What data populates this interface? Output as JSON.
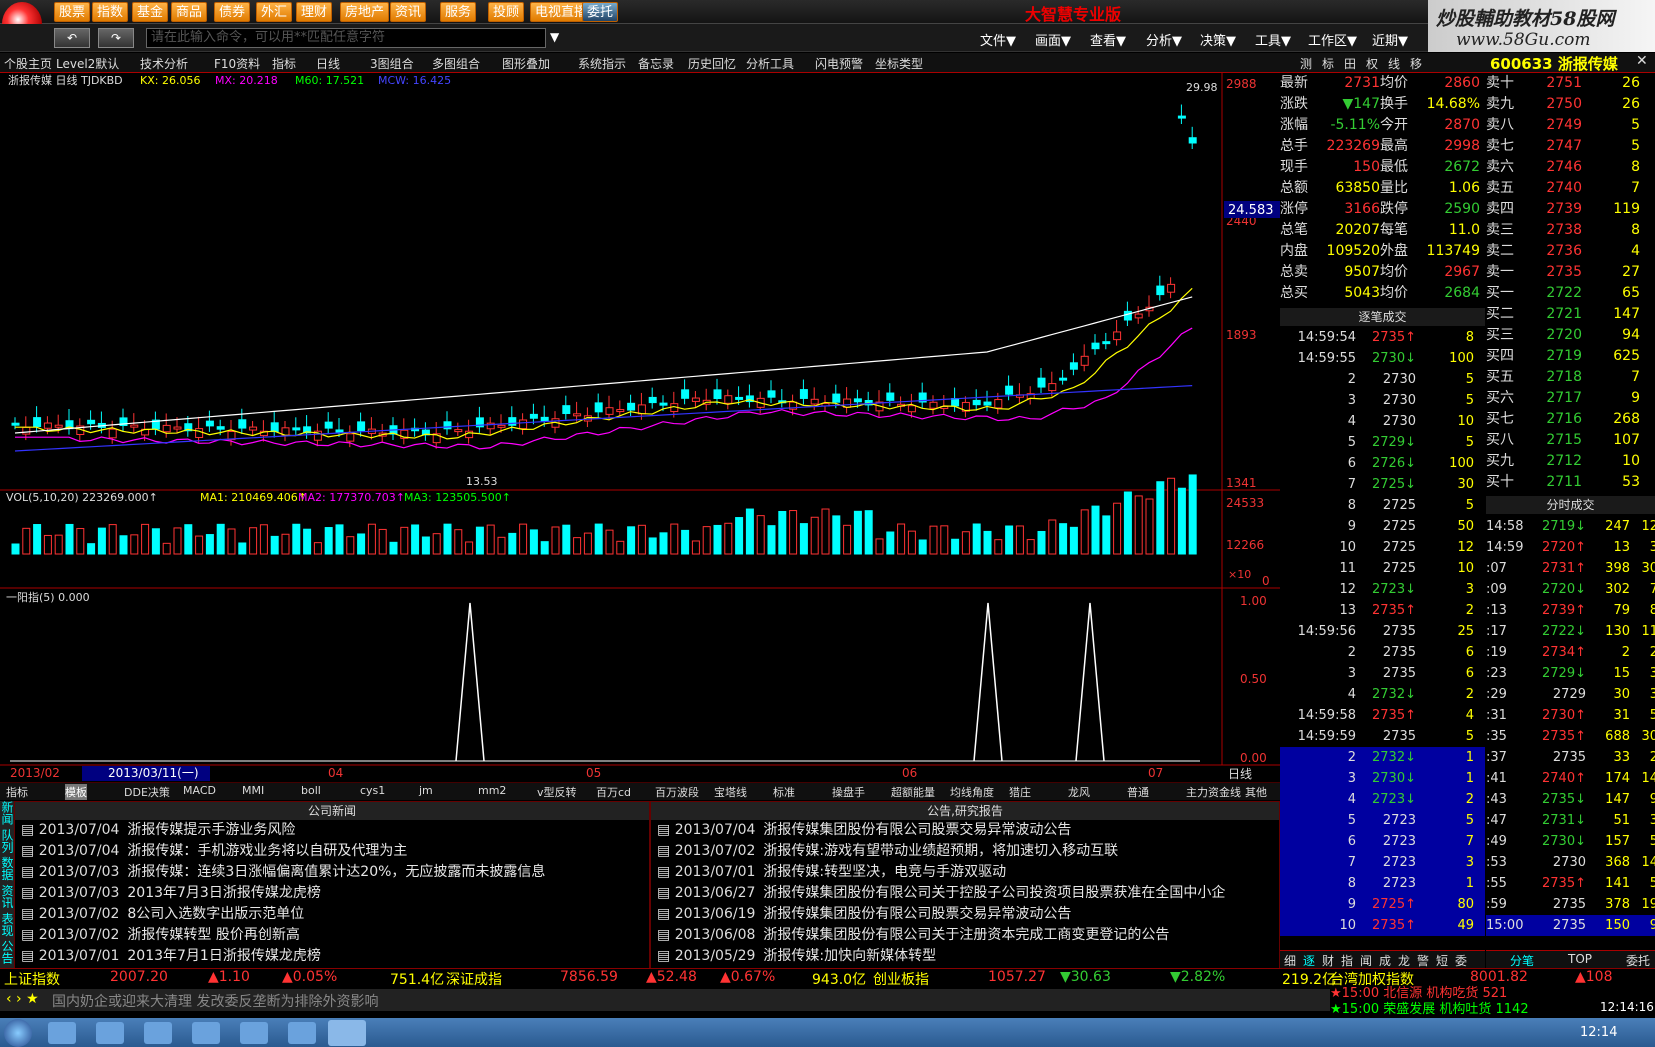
{
  "menu": {
    "items": [
      "股票",
      "指数",
      "基金",
      "商品",
      "债券",
      "外汇",
      "理财",
      "房地产",
      "资讯",
      "服务",
      "投顾",
      "电视直播",
      "委托"
    ],
    "title": "大智慧专业版",
    "cmd_placeholder": "请在此输入命令，可以用**匹配任意字符",
    "right": [
      "文件▼",
      "画面▼",
      "查看▼",
      "分析▼",
      "决策▼",
      "工具▼",
      "工作区▼",
      "近期▼"
    ],
    "banner1": "炒股輔助教材58股网",
    "banner2": "www.58Gu.com"
  },
  "toolbar": {
    "items": [
      "个股主页",
      "Level2默认",
      "技术分析",
      "F10资料",
      "指标",
      "日线",
      "3图组合",
      "多图组合",
      "图形叠加",
      "系统指示",
      "备忘录",
      "历史回忆",
      "分析工具",
      "闪电预警",
      "坐标类型"
    ],
    "right": [
      "测",
      "标",
      "田",
      "权",
      "线",
      "移"
    ],
    "stock": "600633 浙报传媒"
  },
  "chart": {
    "kline_label": "浙报传媒 日线 TJDKBD",
    "ma1": "KX: 26.056",
    "ma2": "MX: 20.218",
    "ma3": "M60: 17.521",
    "ma4": "MCW: 16.425",
    "price_axis": [
      "2988",
      "2440",
      "1893",
      "1341"
    ],
    "cursor_price": "24.583",
    "low_mark": "13.53",
    "high_mark": "29.98",
    "vol_label": "VOL(5,10,20) 223269.000↑",
    "vol_ma1": "MA1: 210469.406↑",
    "vol_ma2": "MA2: 177370.703↑",
    "vol_ma3": "MA3: 123505.500↑",
    "vol_axis": [
      "24533",
      "12266",
      "0"
    ],
    "vol_unit": "×10",
    "ind_label": "一阳指(5) 0.000",
    "ind_axis": [
      "1.00",
      "0.50",
      "0.00"
    ],
    "dates": [
      "2013/02",
      "2013/03/11(一)",
      "04",
      "05",
      "06",
      "07"
    ],
    "period": "日线"
  },
  "tabs": [
    "指标",
    "模板",
    "DDE决策",
    "MACD",
    "MMI",
    "boll",
    "cys1",
    "jm",
    "mm2",
    "v型反转",
    "百万cd",
    "百万波段",
    "宝塔线",
    "标准",
    "操盘手",
    "超额能量",
    "均线角度",
    "猎庄",
    "龙风",
    "普通",
    "主力资金线",
    "其他"
  ],
  "news": {
    "left_title": "公司新闻",
    "right_title": "公告,研究报告",
    "left": [
      [
        "2013/07/04",
        "浙报传媒提示手游业务风险"
      ],
      [
        "2013/07/04",
        "浙报传媒：手机游戏业务将以自研及代理为主"
      ],
      [
        "2013/07/03",
        "浙报传媒：连续3日涨幅偏离值累计达20%，无应披露而未披露信息"
      ],
      [
        "2013/07/03",
        "2013年7月3日浙报传媒龙虎榜"
      ],
      [
        "2013/07/02",
        "8公司入选数字出版示范单位"
      ],
      [
        "2013/07/02",
        "浙报传媒转型 股价再创新高"
      ],
      [
        "2013/07/01",
        "2013年7月1日浙报传媒龙虎榜"
      ]
    ],
    "right": [
      [
        "2013/07/04",
        "浙报传媒集团股份有限公司股票交易异常波动公告"
      ],
      [
        "2013/07/02",
        "浙报传媒:游戏有望带动业绩超预期，将加速切入移动互联"
      ],
      [
        "2013/07/01",
        "浙报传媒:转型坚决，电竞与手游双驱动"
      ],
      [
        "2013/06/27",
        "浙报传媒集团股份有限公司关于控股子公司投资项目股票获准在全国中小企"
      ],
      [
        "2013/06/19",
        "浙报传媒集团股份有限公司股票交易异常波动公告"
      ],
      [
        "2013/06/08",
        "浙报传媒集团股份有限公司关于注册资本完成工商变更登记的公告"
      ],
      [
        "2013/05/29",
        "浙报传媒:加快向新媒体转型"
      ]
    ],
    "side": "新闻 队列 数据 资讯 表现 公告 相关"
  },
  "quote": [
    [
      "最新",
      "2731",
      "均价",
      "2860"
    ],
    [
      "涨跌",
      "▼147",
      "换手",
      "14.68%"
    ],
    [
      "涨幅",
      "-5.11%",
      "今开",
      "2870"
    ],
    [
      "总手",
      "223269",
      "最高",
      "2998"
    ],
    [
      "现手",
      "150",
      "最低",
      "2672"
    ],
    [
      "总额",
      "63850",
      "量比",
      "1.06"
    ],
    [
      "涨停",
      "3166",
      "跌停",
      "2590"
    ],
    [
      "总笔",
      "20207",
      "每笔",
      "11.0"
    ],
    [
      "内盘",
      "109520",
      "外盘",
      "113749"
    ],
    [
      "总卖",
      "9507",
      "均价",
      "2967"
    ],
    [
      "总买",
      "5043",
      "均价",
      "2684"
    ]
  ],
  "orderbook": [
    [
      "卖十",
      "2751",
      "26"
    ],
    [
      "卖九",
      "2750",
      "26"
    ],
    [
      "卖八",
      "2749",
      "5"
    ],
    [
      "卖七",
      "2747",
      "5"
    ],
    [
      "卖六",
      "2746",
      "8"
    ],
    [
      "卖五",
      "2740",
      "7"
    ],
    [
      "卖四",
      "2739",
      "119"
    ],
    [
      "卖三",
      "2738",
      "8"
    ],
    [
      "卖二",
      "2736",
      "4"
    ],
    [
      "卖一",
      "2735",
      "27"
    ],
    [
      "买一",
      "2722",
      "65"
    ],
    [
      "买二",
      "2721",
      "147"
    ],
    [
      "买三",
      "2720",
      "94"
    ],
    [
      "买四",
      "2719",
      "625"
    ],
    [
      "买五",
      "2718",
      "7"
    ],
    [
      "买六",
      "2717",
      "9"
    ],
    [
      "买七",
      "2716",
      "268"
    ],
    [
      "买八",
      "2715",
      "107"
    ],
    [
      "买九",
      "2712",
      "10"
    ],
    [
      "买十",
      "2711",
      "53"
    ]
  ],
  "ticks_title": "逐笔成交",
  "ticks": [
    [
      "14:59:54",
      "2735↑",
      "8"
    ],
    [
      "14:59:55",
      "2730↓",
      "100"
    ],
    [
      "2",
      "2730",
      "5"
    ],
    [
      "3",
      "2730",
      "5"
    ],
    [
      "4",
      "2730",
      "10"
    ],
    [
      "5",
      "2729↓",
      "5"
    ],
    [
      "6",
      "2726↓",
      "100"
    ],
    [
      "7",
      "2725↓",
      "30"
    ],
    [
      "8",
      "2725",
      "5"
    ],
    [
      "9",
      "2725",
      "50"
    ],
    [
      "10",
      "2725",
      "12"
    ],
    [
      "11",
      "2725",
      "10"
    ],
    [
      "12",
      "2723↓",
      "3"
    ],
    [
      "13",
      "2735↑",
      "2"
    ],
    [
      "14:59:56",
      "2735",
      "25"
    ],
    [
      "2",
      "2735",
      "6"
    ],
    [
      "3",
      "2735",
      "6"
    ],
    [
      "4",
      "2732↓",
      "2"
    ],
    [
      "14:59:58",
      "2735↑",
      "4"
    ],
    [
      "14:59:59",
      "2735",
      "5"
    ],
    [
      "2",
      "2732↓",
      "1"
    ],
    [
      "3",
      "2730↓",
      "1"
    ],
    [
      "4",
      "2723↓",
      "2"
    ],
    [
      "5",
      "2723",
      "5"
    ],
    [
      "6",
      "2723",
      "7"
    ],
    [
      "7",
      "2723",
      "3"
    ],
    [
      "8",
      "2723",
      "1"
    ],
    [
      "9",
      "2725↑",
      "80"
    ],
    [
      "10",
      "2735↑",
      "49"
    ]
  ],
  "minute_title": "分时成交",
  "minute": [
    [
      "14:58",
      "2719↓",
      "247",
      "12"
    ],
    [
      "14:59",
      "2720↑",
      "13",
      "3"
    ],
    [
      ":07",
      "2731↑",
      "398",
      "30"
    ],
    [
      ":09",
      "2720↓",
      "302",
      "7"
    ],
    [
      ":13",
      "2739↑",
      "79",
      "8"
    ],
    [
      ":17",
      "2722↓",
      "130",
      "11"
    ],
    [
      ":19",
      "2734↑",
      "2",
      "2"
    ],
    [
      ":23",
      "2729↓",
      "15",
      "3"
    ],
    [
      ":29",
      "2729",
      "30",
      "3"
    ],
    [
      ":31",
      "2730↑",
      "31",
      "5"
    ],
    [
      ":35",
      "2735↑",
      "688",
      "30"
    ],
    [
      ":37",
      "2735",
      "33",
      "2"
    ],
    [
      ":41",
      "2740↑",
      "174",
      "14"
    ],
    [
      ":43",
      "2735↓",
      "147",
      "9"
    ],
    [
      ":47",
      "2731↓",
      "51",
      "3"
    ],
    [
      ":49",
      "2730↓",
      "157",
      "5"
    ],
    [
      ":53",
      "2730",
      "368",
      "14"
    ],
    [
      ":55",
      "2735↑",
      "141",
      "5"
    ],
    [
      ":59",
      "2735",
      "378",
      "19"
    ],
    [
      "15:00",
      "2735",
      "150",
      "9"
    ]
  ],
  "index_bar": [
    "上证指数",
    "2007.20",
    "▲1.10",
    "▲0.05%",
    "751.4亿",
    "深证成指",
    "7856.59",
    "▲52.48",
    "▲0.67%",
    "943.0亿",
    "创业板指",
    "1057.27",
    "▼30.63",
    "▼2.82%",
    "219.2亿",
    "台湾加权指数",
    "8001.82",
    "▲108"
  ],
  "bottom_tabs": [
    "细",
    "逐",
    "财",
    "指",
    "闻",
    "成",
    "龙",
    "警",
    "短",
    "委"
  ],
  "bottom_right": [
    "分笔",
    "TOP",
    "委托"
  ],
  "news_ticker": "国内奶企或迎来大清理 发改委反垄断为排除外资影响",
  "alerts": [
    "★15:00 北信源 机构吃货 521",
    "★15:00 荣盛发展 机构吐货 1142"
  ],
  "clock": "12:14:16",
  "tray_time": "12:14"
}
